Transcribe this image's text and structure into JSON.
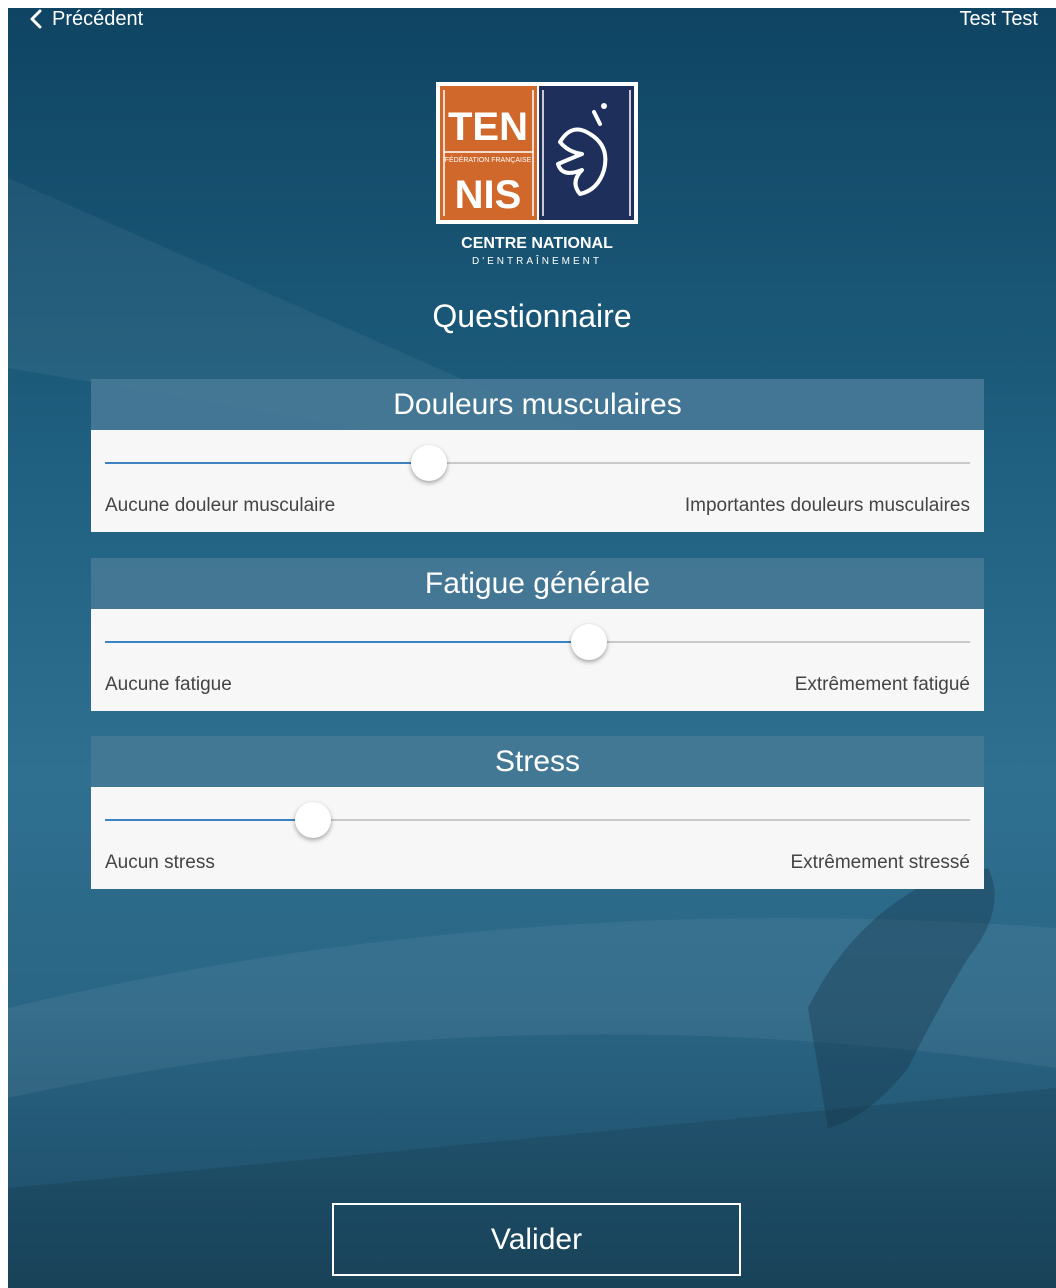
{
  "nav": {
    "back_label": "Précédent",
    "user_name": "Test Test"
  },
  "logo": {
    "line1": "TEN",
    "line2": "NIS",
    "federation": "FÉDÉRATION FRANÇAISE",
    "centre": "CENTRE NATIONAL",
    "entrainement": "D'ENTRAÎNEMENT"
  },
  "page": {
    "title": "Questionnaire"
  },
  "questions": [
    {
      "heading": "Douleurs musculaires",
      "min_label": "Aucune douleur musculaire",
      "max_label": "Importantes douleurs musculaires",
      "value": 0.375
    },
    {
      "heading": "Fatigue générale",
      "min_label": "Aucune fatigue",
      "max_label": "Extrêmement fatigué",
      "value": 0.56
    },
    {
      "heading": "Stress",
      "min_label": "Aucun stress",
      "max_label": "Extrêmement stressé",
      "value": 0.24
    }
  ],
  "actions": {
    "submit_label": "Valider"
  },
  "colors": {
    "slider_fill": "#3f82c2",
    "card_header": "#457896",
    "logo_orange": "#d0682c",
    "logo_navy": "#1e2f5c"
  }
}
